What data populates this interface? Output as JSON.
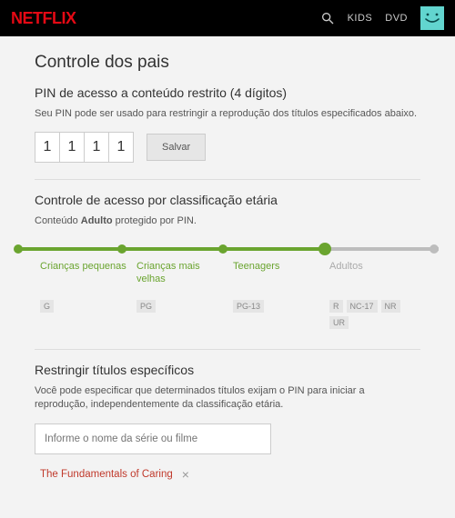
{
  "topbar": {
    "logo": "NETFLIX",
    "kids": "KIDS",
    "dvd": "DVD"
  },
  "page": {
    "title": "Controle dos pais"
  },
  "pin": {
    "heading": "PIN de acesso a conteúdo restrito (4 dígitos)",
    "desc": "Seu PIN pode ser usado para restringir a reprodução dos títulos especificados abaixo.",
    "d1": "1",
    "d2": "1",
    "d3": "1",
    "d4": "1",
    "save": "Salvar"
  },
  "maturity": {
    "heading": "Controle de acesso por classificação etária",
    "desc_pre": "Conteúdo ",
    "desc_bold": "Adulto",
    "desc_post": " protegido por PIN.",
    "levels": [
      {
        "label": "Crianças pequenas",
        "ratings": [
          "G"
        ],
        "active": true
      },
      {
        "label": "Crianças mais velhas",
        "ratings": [
          "PG"
        ],
        "active": true
      },
      {
        "label": "Teenagers",
        "ratings": [
          "PG-13"
        ],
        "active": true
      },
      {
        "label": "Adultos",
        "ratings": [
          "R",
          "NC-17",
          "NR",
          "UR"
        ],
        "active": false
      }
    ]
  },
  "restrict": {
    "heading": "Restringir títulos específicos",
    "desc": "Você pode especificar que determinados títulos exijam o PIN para iniciar a reprodução, independentemente da classificação etária.",
    "placeholder": "Informe o nome da série ou filme",
    "items": [
      "The Fundamentals of Caring"
    ]
  }
}
